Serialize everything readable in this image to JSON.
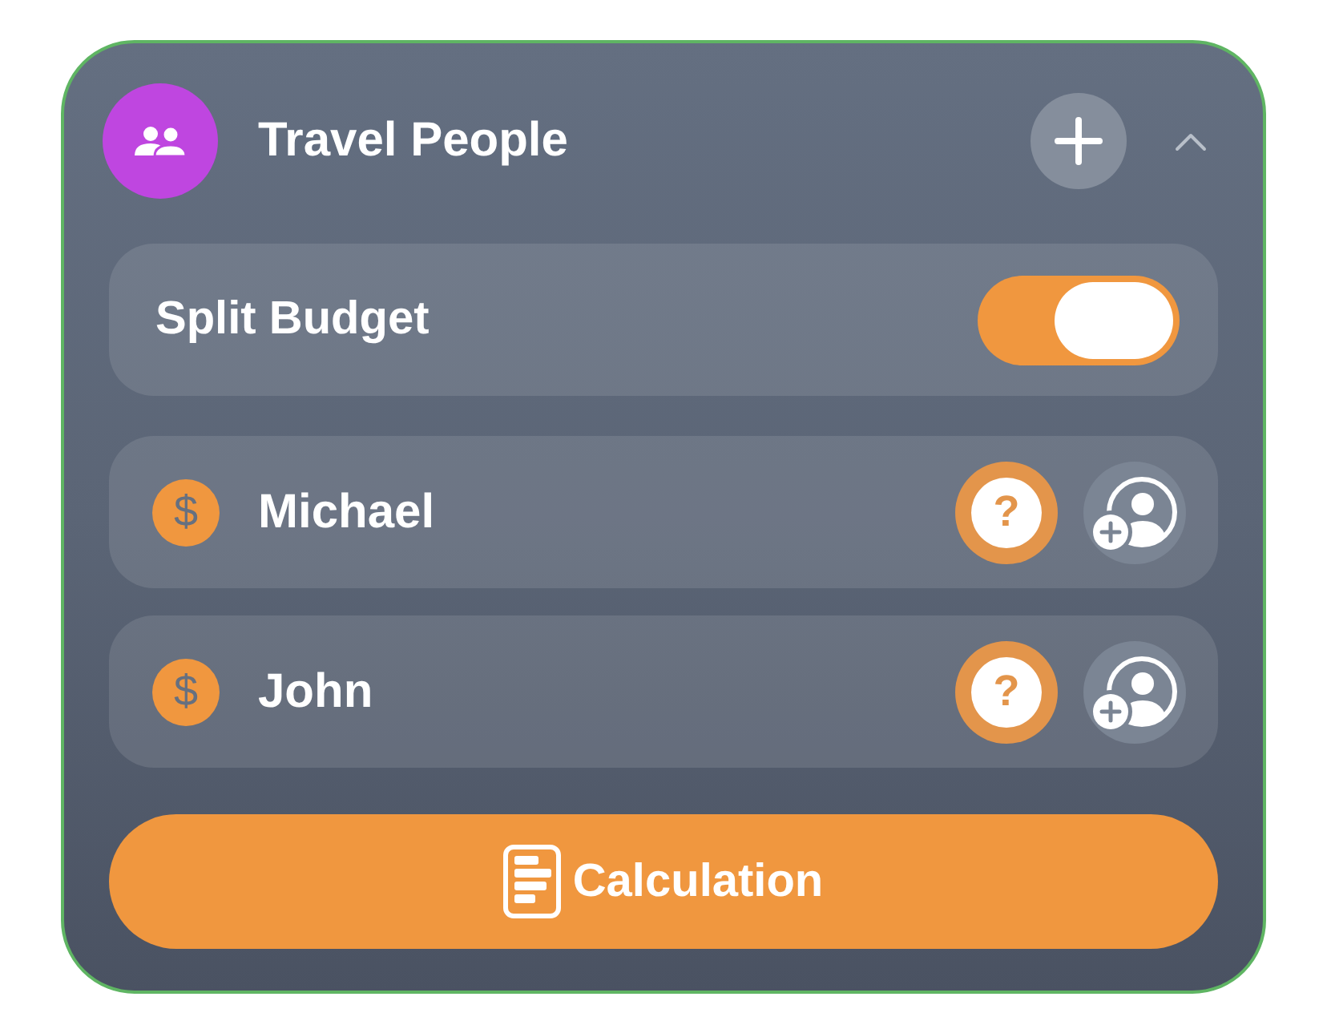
{
  "header": {
    "title": "Travel People",
    "expanded": true
  },
  "split_budget": {
    "label": "Split Budget",
    "on": true
  },
  "people": [
    {
      "name": "Michael",
      "currency_symbol": "$",
      "help_badge": "?"
    },
    {
      "name": "John",
      "currency_symbol": "$",
      "help_badge": "?"
    }
  ],
  "calculate_button": {
    "label": "Calculation"
  }
}
